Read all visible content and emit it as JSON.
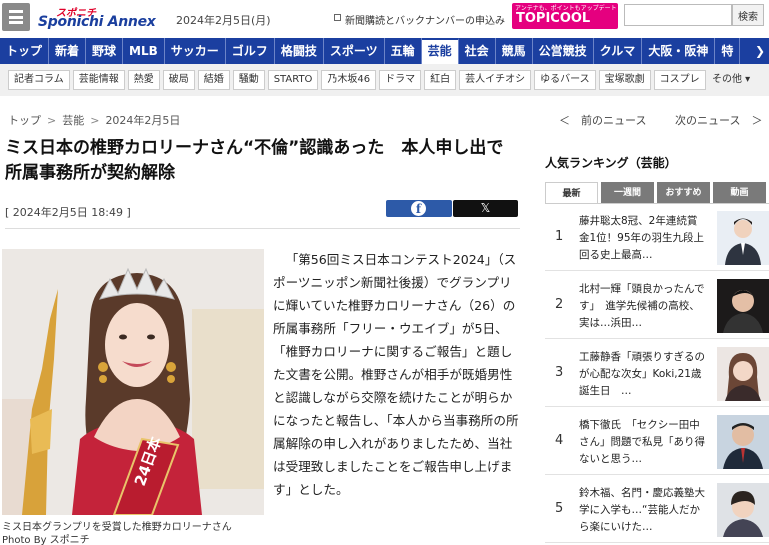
{
  "header": {
    "logo_top": "スポニチ",
    "logo_main": "Sponichi Annex",
    "date": "2024年2月5日(月)",
    "subscription_link": "新聞購読とバックナンバーの申込み",
    "topicool_tagline": "アンテナも、ポイントもアップデート",
    "topicool_name": "TOPICOOL",
    "search_placeholder": "",
    "search_button": "検索"
  },
  "nav": {
    "items": [
      "トップ",
      "新着",
      "野球",
      "MLB",
      "サッカー",
      "ゴルフ",
      "格闘技",
      "スポーツ",
      "五輪",
      "芸能",
      "社会",
      "競馬",
      "公営競技",
      "クルマ",
      "大阪・阪神",
      "特"
    ],
    "active_index": 9,
    "more_arrow": "❯"
  },
  "subnav": {
    "items": [
      "記者コラム",
      "芸能情報",
      "熱愛",
      "破局",
      "結婚",
      "騒動",
      "STARTO",
      "乃木坂46",
      "ドラマ",
      "紅白",
      "芸人イチオシ",
      "ゆるバース",
      "宝塚歌劇",
      "コスプレ"
    ],
    "more": "その他 ▾"
  },
  "breadcrumb": [
    "トップ",
    "芸能",
    "2024年2月5日"
  ],
  "article": {
    "title": "ミス日本の椎野カロリーナさん“不倫”認識あった　本人申し出で所属事務所が契約解除",
    "date": "[ 2024年2月5日 18:49 ]",
    "share_facebook": "f",
    "share_x": "𝕏",
    "photo_sash_text": "24日本",
    "photo_caption": "ミス日本グランプリを受賞した椎野カロリーナさん",
    "photo_credit": "Photo By スポニチ",
    "body": "「第56回ミス日本コンテスト2024」（スポーツニッポン新聞社後援）でグランプリに輝いていた椎野カロリーナさん（26）の所属事務所「フリー・ウエイブ」が5日、「椎野カロリーナに関するご報告」と題した文書を公開。椎野さんが相手が既婚男性と認識しながら交際を続けたことが明らかになったと報告し、「本人から当事務所の所属解除の申し入れがありましたため、当社は受理致しましたことをご報告申し上げます」とした。"
  },
  "sidebar": {
    "prev": "＜　前のニュース",
    "next": "次のニュース　＞",
    "ranking_title": "人気ランキング（芸能）",
    "tabs": [
      "最新",
      "一週間",
      "おすすめ",
      "動画"
    ],
    "active_tab": 0,
    "ranking": [
      {
        "rank": "1",
        "text": "藤井聡太8冠、2年連続賞金1位！95年の羽生九段上回る史上最高…"
      },
      {
        "rank": "2",
        "text": "北村一輝「頭良かったんです」　進学先候補の高校、実は…浜田…"
      },
      {
        "rank": "3",
        "text": "工藤静香「頑張りすぎるのが心配な次女」Koki,21歳誕生日　…"
      },
      {
        "rank": "4",
        "text": "橋下徹氏　「セクシー田中さん」問題で私見「あり得ないと思う…"
      },
      {
        "rank": "5",
        "text": "鈴木福、名門・慶応義塾大学に入学も…“芸能人だから楽にいけた…"
      }
    ]
  }
}
